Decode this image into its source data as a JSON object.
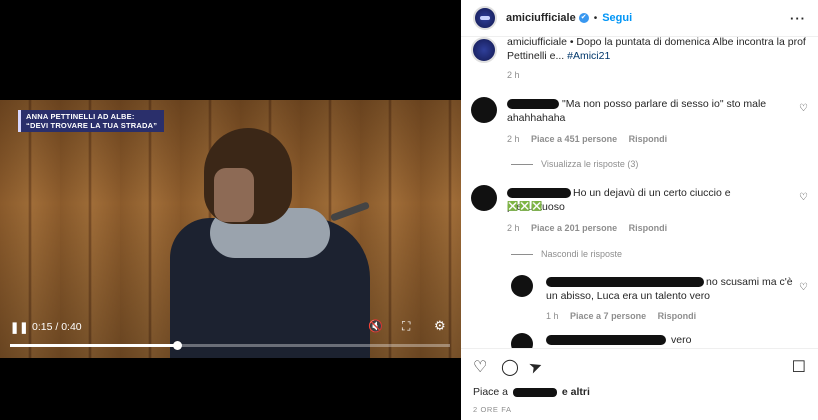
{
  "video": {
    "lower_third": {
      "line1": "ANNA PETTINELLI AD ALBE:",
      "line2": "“DEVI TROVARE LA TUA STRADA”"
    },
    "time": "0:15 / 0:40",
    "progress": 0.38,
    "icons": {
      "pause": "pause-icon",
      "mute": "muted-speaker-icon",
      "fullscreen": "fullscreen-icon",
      "settings": "gear-icon"
    },
    "glyphs": {
      "pause": "❚❚",
      "mute": "🔇",
      "fullscreen": "⛶",
      "settings": "⚙"
    }
  },
  "post": {
    "username": "amiciufficiale",
    "verified": "✔",
    "separator": "•",
    "follow_label": "Segui",
    "more": "···"
  },
  "caption": {
    "text": "amiciufficiale • Dopo la puntata di domenica Albe incontra la prof Pettinelli e... ",
    "hashtag": "#Amici21",
    "time": "2 h"
  },
  "comments": [
    {
      "text": "\"Ma non posso parlare di sesso io\" sto male ahahhahaha",
      "time": "2 h",
      "likes": "Piace a 451 persone",
      "reply": "Rispondi",
      "thread": "Visualizza le risposte (3)"
    },
    {
      "text": "Ho un dejavù di un certo ciuccio e presuntuoso",
      "emojis": "❎❎❎",
      "time": "2 h",
      "likes": "Piace a 201 persone",
      "reply": "Rispondi",
      "thread": "Nascondi le risposte"
    }
  ],
  "replies": [
    {
      "text": "no scusami ma c'è un abisso, Luca era un talento vero",
      "time": "1 h",
      "likes": "Piace a 7 persone",
      "reply": "Rispondi"
    },
    {
      "text": "vero"
    }
  ],
  "actions": {
    "icons": [
      "heart-icon",
      "comment-icon",
      "share-icon",
      "bookmark-icon"
    ],
    "glyphs": {
      "heart": "♡",
      "comment": "◯",
      "share": "➤",
      "bookmark": "☐"
    },
    "likes_prefix": "Piace a",
    "likes_suffix": "e altri",
    "posted": "2 ORE FA"
  }
}
